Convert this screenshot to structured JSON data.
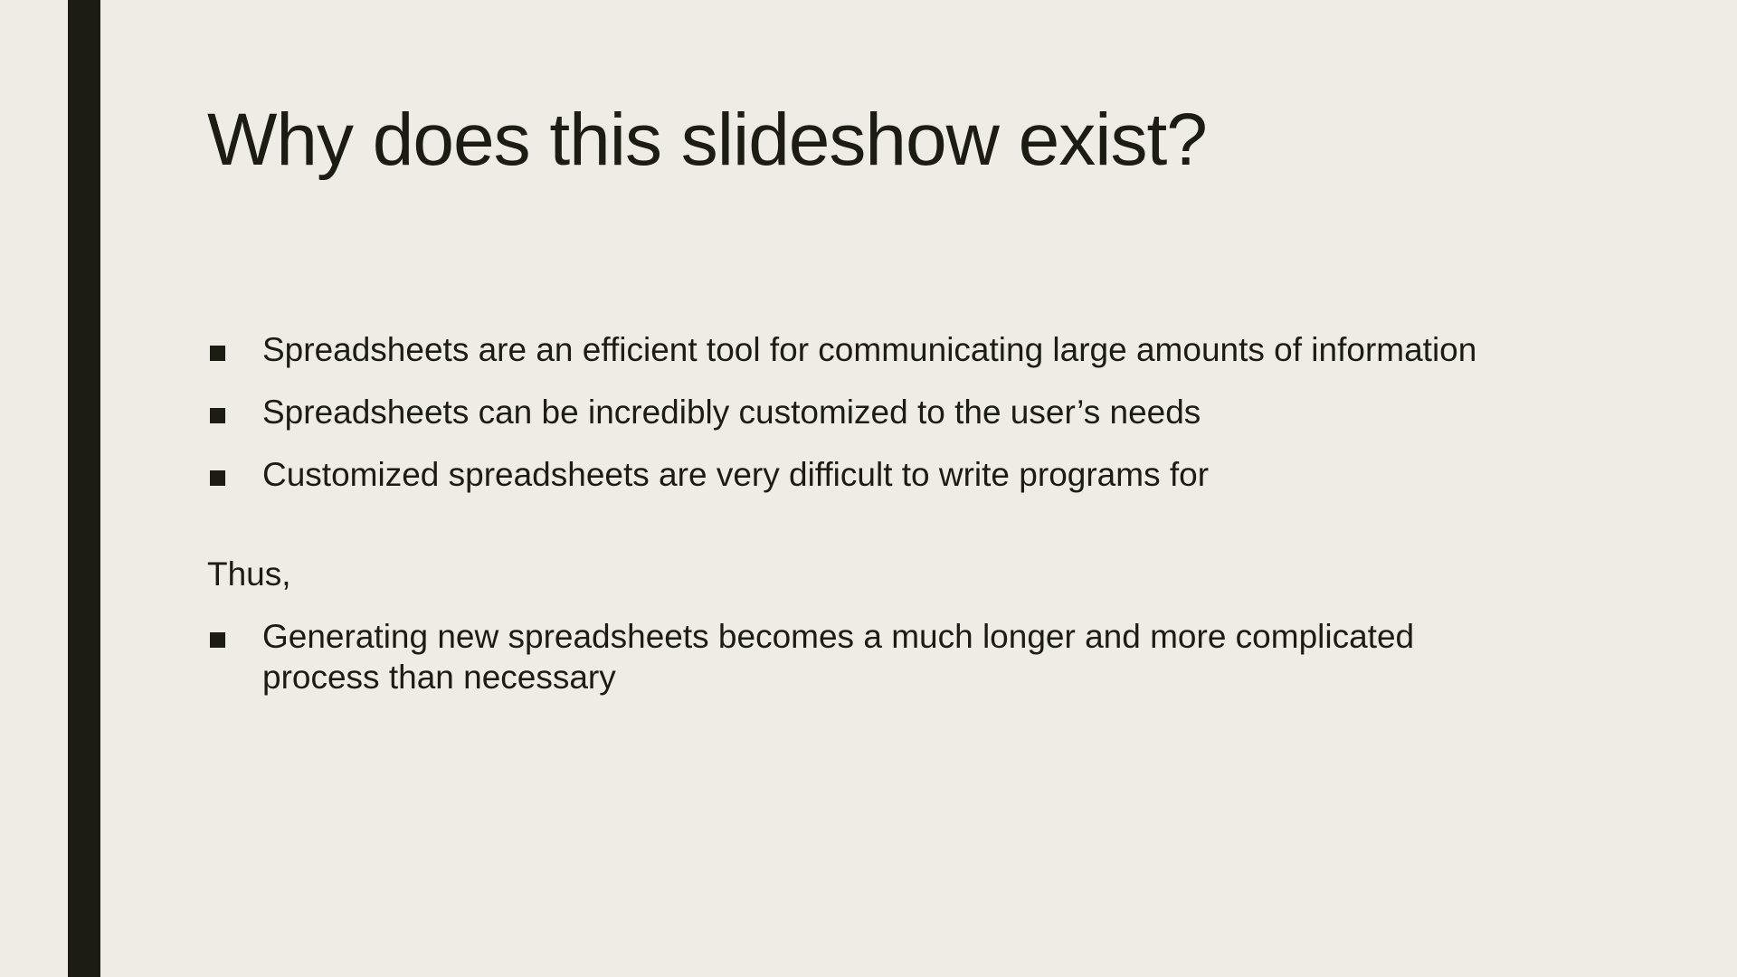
{
  "slide": {
    "title": "Why does this slideshow exist?",
    "bullets": [
      "Spreadsheets are an efficient tool for communicating large amounts of information",
      "Spreadsheets can be incredibly customized to the user’s needs",
      "Customized spreadsheets are very difficult to write programs for"
    ],
    "transition_text": "Thus,",
    "conclusion_bullets": [
      "Generating new spreadsheets becomes a much longer and more complicated process than necessary"
    ]
  },
  "colors": {
    "background": "#eeece4",
    "text": "#1c1c12",
    "accent_bar": "#1c1c12"
  },
  "icons": {
    "bullet": "square-bullet-icon"
  }
}
